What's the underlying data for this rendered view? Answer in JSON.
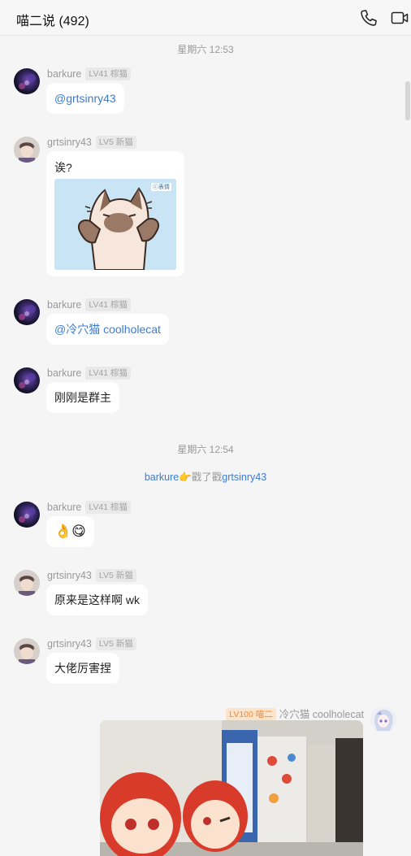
{
  "header": {
    "title": "喵二说 (492)"
  },
  "timestamps": [
    "星期六 12:53",
    "星期六 12:54"
  ],
  "messages": [
    {
      "user": "barkure",
      "level": "LV41 棕猫",
      "text": "@grtsinry43"
    },
    {
      "user": "grtsinry43",
      "level": "LV5 新猫",
      "text": "诶?",
      "image_watermark": "ⓒ表情"
    },
    {
      "user": "barkure",
      "level": "LV41 棕猫",
      "text": "@冷穴猫 coolholecat"
    },
    {
      "user": "barkure",
      "level": "LV41 棕猫",
      "text": "刚刚是群主"
    },
    {
      "user": "barkure",
      "level": "LV41 棕猫",
      "text": "👌😋"
    },
    {
      "user": "grtsinry43",
      "level": "LV5 新猫",
      "text": "原来是这样啊 wk"
    },
    {
      "user": "grtsinry43",
      "level": "LV5 新猫",
      "text": "大佬厉害捏"
    },
    {
      "user": "冷穴猫 coolholecat",
      "level": "LV100 喵二"
    }
  ],
  "system_notice": {
    "actor": "barkure",
    "action": "👉戳了戳",
    "target": "grtsinry43"
  }
}
